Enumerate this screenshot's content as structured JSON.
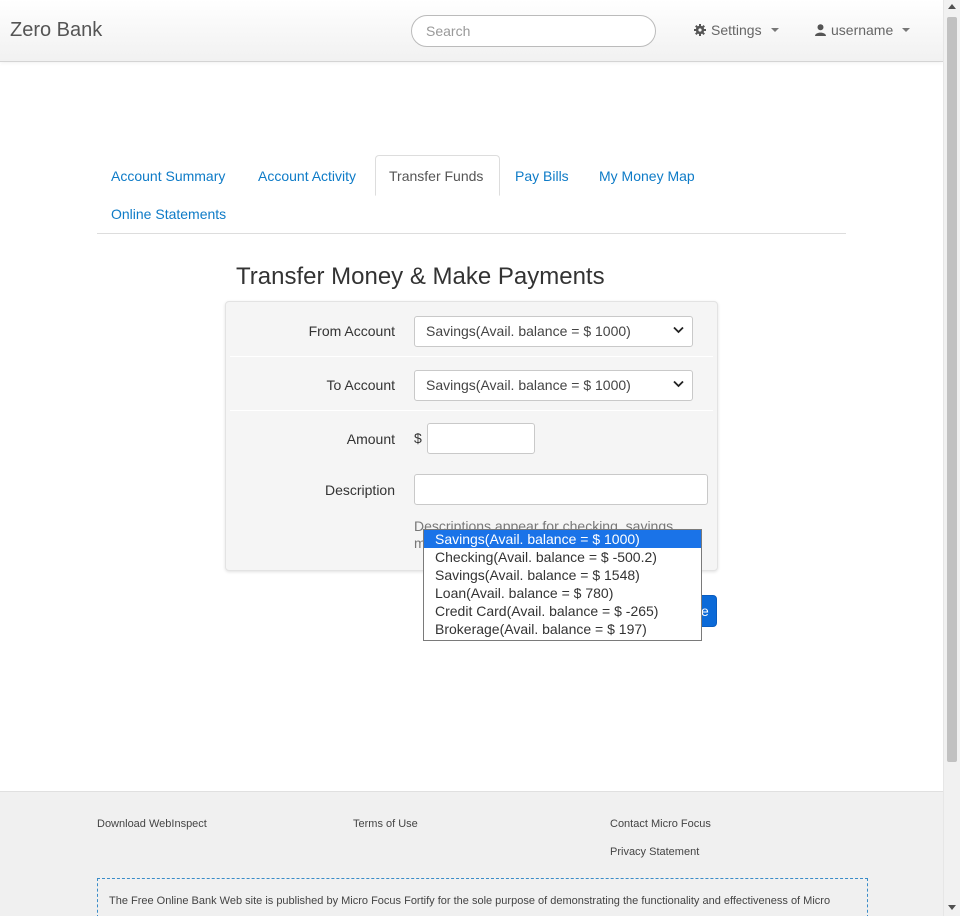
{
  "navbar": {
    "brand": "Zero Bank",
    "search_placeholder": "Search",
    "settings_label": "Settings",
    "user_label": "username"
  },
  "tabs": [
    {
      "label": "Account Summary"
    },
    {
      "label": "Account Activity"
    },
    {
      "label": "Transfer Funds",
      "active": true
    },
    {
      "label": "Pay Bills"
    },
    {
      "label": "My Money Map"
    },
    {
      "label": "Online Statements"
    }
  ],
  "page_title": "Transfer Money & Make Payments",
  "form": {
    "from_label": "From Account",
    "from_value": "Savings(Avail. balance = $ 1000)",
    "to_label": "To Account",
    "to_value": "Savings(Avail. balance = $ 1000)",
    "amount_label": "Amount",
    "currency_symbol": "$",
    "amount_value": "",
    "description_label": "Description",
    "description_value": "",
    "help_line1": "Descriptions appear for checking, savings,",
    "help_line2": "m",
    "submit_partial_label": "e"
  },
  "dropdown": {
    "options": [
      {
        "label": "Savings(Avail. balance = $ 1000)",
        "selected": true
      },
      {
        "label": "Checking(Avail. balance = $ -500.2)"
      },
      {
        "label": "Savings(Avail. balance = $ 1548)"
      },
      {
        "label": "Loan(Avail. balance = $ 780)"
      },
      {
        "label": "Credit Card(Avail. balance = $ -265)"
      },
      {
        "label": "Brokerage(Avail. balance = $ 197)"
      }
    ]
  },
  "footer": {
    "download": "Download WebInspect",
    "terms": "Terms of Use",
    "contact": "Contact Micro Focus",
    "privacy": "Privacy Statement",
    "disclaimer": "The Free Online Bank Web site is published by Micro Focus Fortify for the sole purpose of demonstrating the functionality and effectiveness of Micro"
  },
  "colors": {
    "link": "#0e7bc7",
    "selected_option": "#1a73e8",
    "submit_button": "#0b6ad8"
  }
}
